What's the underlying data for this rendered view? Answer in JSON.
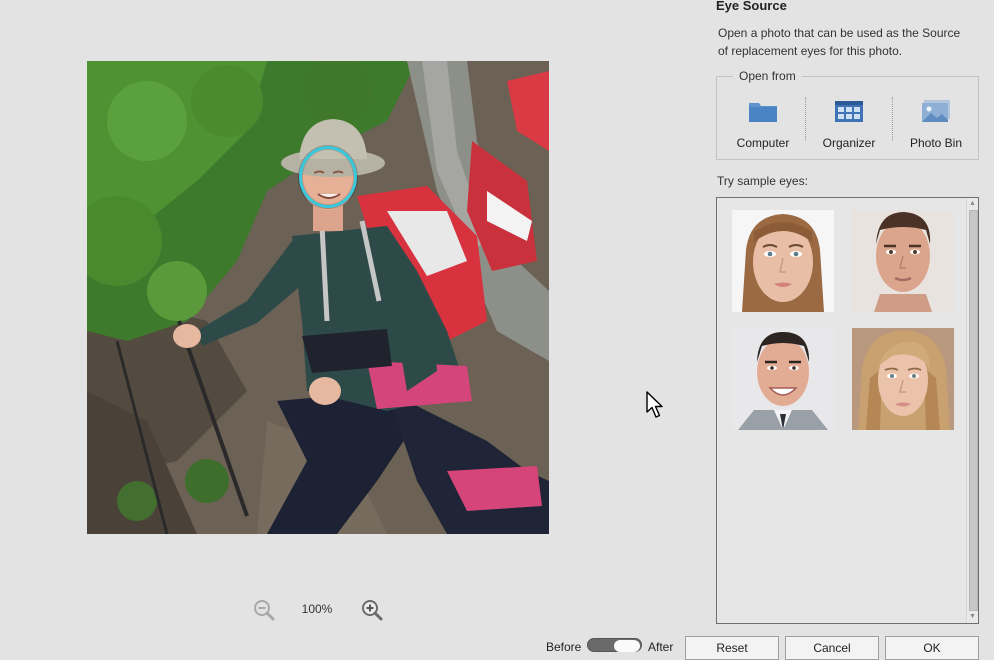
{
  "zoom": {
    "level": "100%"
  },
  "toggle": {
    "before_label": "Before",
    "after_label": "After",
    "after_selected": true
  },
  "buttons": {
    "reset": "Reset",
    "cancel": "Cancel",
    "ok": "OK"
  },
  "panel": {
    "title": "Eye Source",
    "description": "Open a photo that can be used as the Source of replacement eyes for this photo.",
    "open_from": {
      "legend": "Open from",
      "sources": [
        {
          "label": "Computer",
          "icon": "folder-icon"
        },
        {
          "label": "Organizer",
          "icon": "grid-icon"
        },
        {
          "label": "Photo Bin",
          "icon": "image-icon"
        }
      ]
    },
    "samples_label": "Try sample eyes:",
    "samples": [
      {
        "name": "sample-face-1"
      },
      {
        "name": "sample-face-2"
      },
      {
        "name": "sample-face-3"
      },
      {
        "name": "sample-face-4"
      }
    ]
  },
  "colors": {
    "eye_ring": "#38c8dc",
    "background": "#e3e3e3"
  }
}
